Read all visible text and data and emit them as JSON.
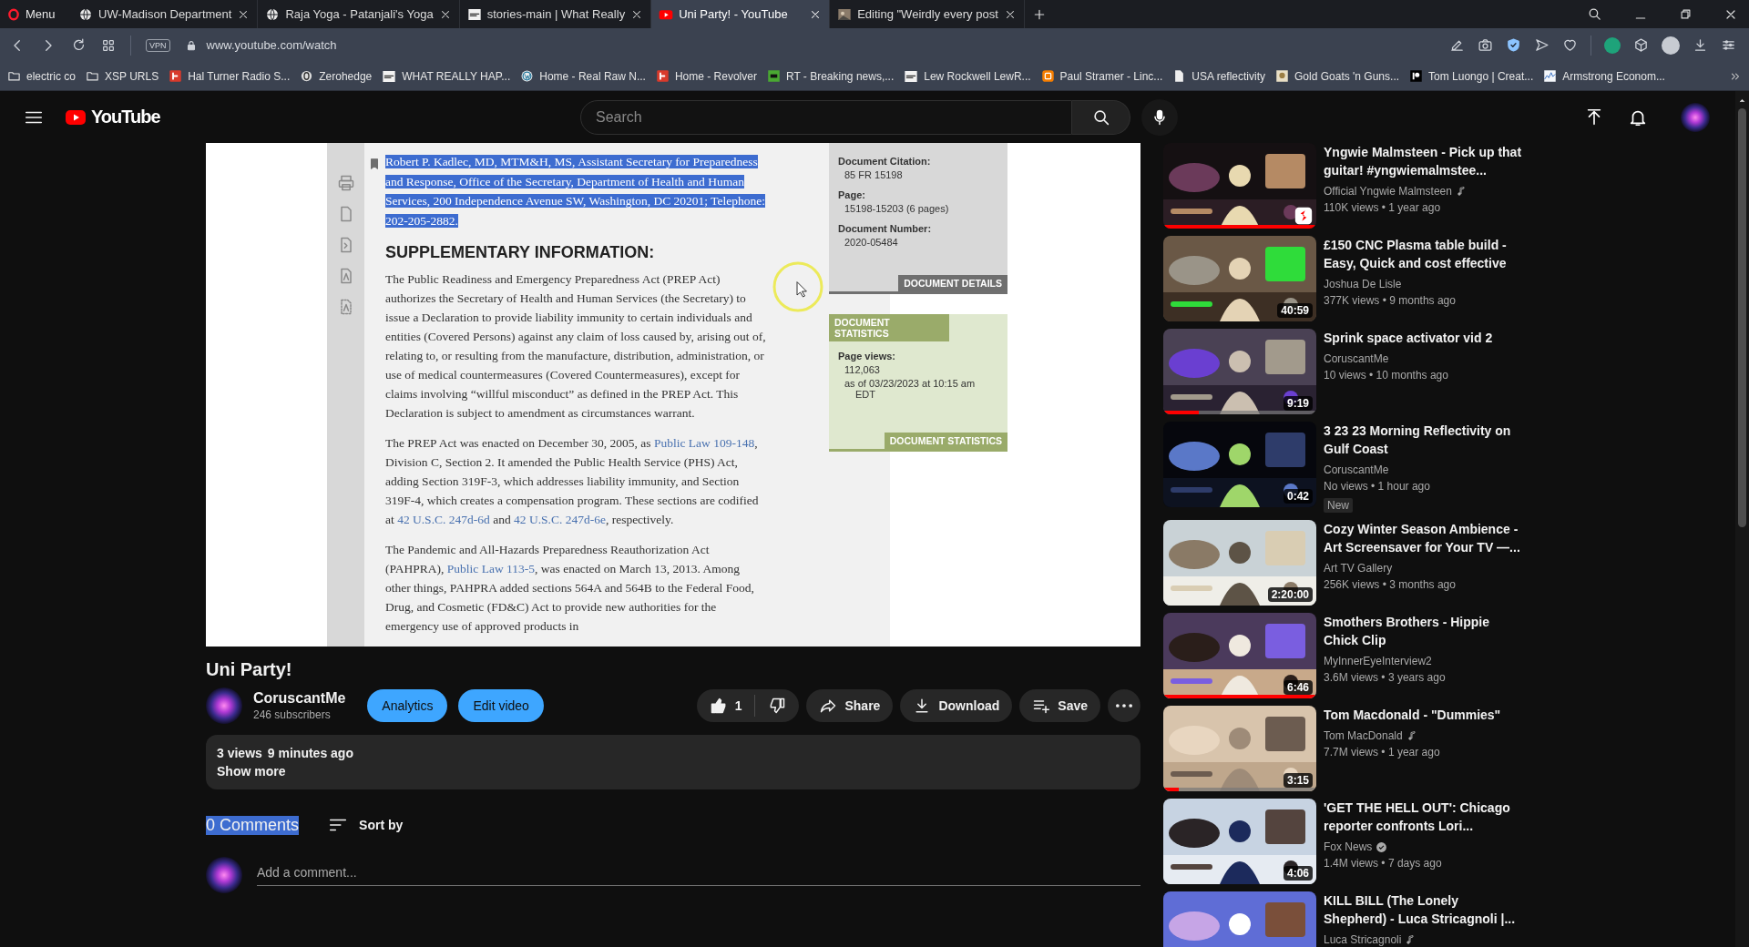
{
  "browser": {
    "menu": "Menu",
    "tabs": [
      {
        "title": "UW-Madison Department",
        "kind": "globe",
        "selected": false
      },
      {
        "title": "Raja Yoga - Patanjali's Yoga",
        "kind": "globe",
        "selected": false
      },
      {
        "title": "stories-main | What Really",
        "kind": "square",
        "selected": false
      },
      {
        "title": "Uni Party! - YouTube",
        "kind": "youtube",
        "selected": true
      },
      {
        "title": "Editing \"Weirdly every post",
        "selected": false
      }
    ],
    "url": "www.youtube.com/watch",
    "vpn": "VPN",
    "bookmarks": [
      {
        "title": "electric co",
        "kind": "folder"
      },
      {
        "title": "XSP URLS",
        "kind": "folder"
      },
      {
        "title": "Hal Turner Radio S...",
        "kind": "red"
      },
      {
        "title": "Zerohedge",
        "kind": "ring"
      },
      {
        "title": "WHAT REALLY HAP...",
        "kind": "square"
      },
      {
        "title": "Home - Real Raw N...",
        "kind": "wordpress"
      },
      {
        "title": "Home - Revolver",
        "kind": "red"
      },
      {
        "title": "RT - Breaking news,...",
        "kind": "green"
      },
      {
        "title": "Lew Rockwell LewR...",
        "kind": "square"
      },
      {
        "title": "Paul Stramer - Linc...",
        "kind": "orange"
      },
      {
        "title": "USA reflectivity",
        "kind": "file"
      },
      {
        "title": "Gold Goats 'n Guns...",
        "kind": "beige"
      },
      {
        "title": "Tom Luongo | Creat...",
        "kind": "black"
      },
      {
        "title": "Armstrong Econom...",
        "kind": "chart"
      }
    ]
  },
  "masthead": {
    "logo": "YouTube",
    "search_placeholder": "Search"
  },
  "document": {
    "contact": {
      "text": "Robert P. Kadlec, MD, MTM&H, MS, Assistant Secretary for Preparedness and Response, Office of the Secretary, Department of Health and Human Services, 200 Independence Avenue SW, Washington, DC 20201; Telephone: 202-205-2882.",
      "selected": true
    },
    "heading": "SUPPLEMENTARY INFORMATION:",
    "paragraphs": [
      [
        {
          "text": "The Public Readiness and Emergency Preparedness Act (PREP Act) authorizes the Secretary of Health and Human Services (the Secretary) to issue a Declaration to provide liability immunity to certain individuals and entities (Covered Persons) against any claim of loss caused by, arising out of, relating to, or resulting from the manufacture, distribution, administration, or use of medical countermeasures (Covered Countermeasures), except for claims involving “willful misconduct” as defined in the PREP Act. This Declaration is subject to amendment as circumstances warrant.",
          "link": false
        }
      ],
      [
        {
          "text": "The PREP Act was enacted on December 30, 2005, as ",
          "link": false
        },
        {
          "text": "Public Law 109-148",
          "link": true
        },
        {
          "text": ", Division C, Section 2. It amended the Public Health Service (PHS) Act, adding Section 319F-3, which addresses liability immunity, and Section 319F-4, which creates a compensation program. These sections are codified at ",
          "link": false
        },
        {
          "text": "42 U.S.C. 247d-6d",
          "link": true
        },
        {
          "text": " and ",
          "link": false
        },
        {
          "text": "42 U.S.C. 247d-6e",
          "link": true
        },
        {
          "text": ", respectively.",
          "link": false
        }
      ],
      [
        {
          "text": "The Pandemic and All-Hazards Preparedness Reauthorization Act (PAHPRA), ",
          "link": false
        },
        {
          "text": "Public Law 113-5",
          "link": true
        },
        {
          "text": ", was enacted on March 13, 2013. Among other things, PAHPRA added sections 564A and 564B to the Federal Food, Drug, and Cosmetic (FD&C) Act to provide new authorities for the emergency use of approved products in",
          "link": false
        }
      ]
    ],
    "details": [
      {
        "label": "Document Citation:",
        "value": "85 FR 15198"
      },
      {
        "label": "Page:",
        "value": "15198-15203 (6 pages)"
      },
      {
        "label": "Document Number:",
        "value": "2020-05484"
      }
    ],
    "details_tab": "DOCUMENT DETAILS",
    "stats_title": "DOCUMENT STATISTICS",
    "stats": [
      {
        "label": "Page views:",
        "lines": [
          "112,063",
          "as of 03/23/2023 at 10:15 am EDT"
        ]
      }
    ],
    "stats_footer": "DOCUMENT STATISTICS"
  },
  "title": "Uni Party!",
  "channel": {
    "name": "CoruscantMe",
    "subscribers": "246 subscribers"
  },
  "owner_buttons": [
    "Analytics",
    "Edit video"
  ],
  "actions": {
    "likes": "1",
    "share": "Share",
    "download": "Download",
    "save": "Save"
  },
  "description": {
    "views": "3 views",
    "age": "9 minutes ago",
    "more": "Show more"
  },
  "comments": {
    "count": {
      "text": "0 Comments",
      "selected": true
    },
    "sort": "Sort by",
    "placeholder": "Add a comment..."
  },
  "sidebar": [
    {
      "title": "Yngwie Malmsteen - Pick up that guitar! #yngwiemalmstee...",
      "channel": "Official Yngwie Malmsteen",
      "music_note": true,
      "verified": false,
      "meta": "110K views • 1 year ago",
      "kind": "short",
      "level": 1
    },
    {
      "title": "£150 CNC Plasma table build - Easy, Quick and cost effective",
      "channel": "Joshua De Lisle",
      "music_note": false,
      "verified": false,
      "meta": "377K views • 9 months ago",
      "kind": "video",
      "duration": "40:59"
    },
    {
      "title": "Sprink space activator vid 2",
      "channel": "CoruscantMe",
      "music_note": false,
      "verified": false,
      "meta": "10 views • 10 months ago",
      "kind": "video",
      "duration": "9:19",
      "level": 0.23
    },
    {
      "title": "3 23 23 Morning Reflectivity on Gulf Coast",
      "channel": "CoruscantMe",
      "music_note": false,
      "verified": false,
      "meta": "No views • 1 hour ago",
      "tag": "New",
      "kind": "video",
      "duration": "0:42"
    },
    {
      "title": "Cozy Winter Season Ambience - Art Screensaver for Your TV —...",
      "channel": "Art TV Gallery",
      "music_note": false,
      "verified": false,
      "meta": "256K views • 3 months ago",
      "kind": "video",
      "duration": "2:20:00"
    },
    {
      "title": "Smothers Brothers - Hippie Chick Clip",
      "channel": "MyInnerEyeInterview2",
      "music_note": false,
      "verified": false,
      "meta": "3.6M views • 3 years ago",
      "kind": "video",
      "duration": "6:46",
      "level": 1
    },
    {
      "title": "Tom Macdonald - \"Dummies\"",
      "channel": "Tom MacDonald",
      "music_note": true,
      "verified": false,
      "meta": "7.7M views • 1 year ago",
      "kind": "video",
      "duration": "3:15",
      "level": 0.1
    },
    {
      "title": "'GET THE HELL OUT': Chicago reporter confronts Lori...",
      "channel": "Fox News",
      "music_note": false,
      "verified": true,
      "meta": "1.4M views • 7 days ago",
      "kind": "video",
      "duration": "4:06"
    },
    {
      "title": "KILL BILL (The Lonely Shepherd) - Luca Stricagnoli |...",
      "channel": "Luca Stricagnoli",
      "music_note": true,
      "verified": false,
      "kind": "video"
    }
  ]
}
